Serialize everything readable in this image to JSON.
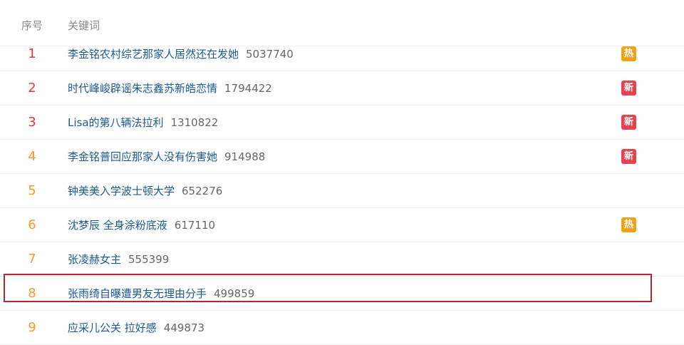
{
  "header": {
    "rank_label": "序号",
    "keyword_label": "关键词"
  },
  "colors": {
    "rank_top": "#e5393a",
    "rank_rest": "#f59b2b",
    "link": "#1a5a93",
    "tag_hot": "#f0a317",
    "tag_new": "#e8424c",
    "highlight": "#b8252c"
  },
  "rows": [
    {
      "rank": "1",
      "keyword": "李金铭农村综艺那家人居然还在发她",
      "count": "5037740",
      "tag": "热",
      "tag_type": "hot"
    },
    {
      "rank": "2",
      "keyword": "时代峰峻辟谣朱志鑫苏新皓恋情",
      "count": "1794422",
      "tag": "新",
      "tag_type": "new"
    },
    {
      "rank": "3",
      "keyword": "Lisa的第八辆法拉利",
      "count": "1310822",
      "tag": "新",
      "tag_type": "new"
    },
    {
      "rank": "4",
      "keyword": "李金铭普回应那家人没有伤害她",
      "count": "914988",
      "tag": "新",
      "tag_type": "new"
    },
    {
      "rank": "5",
      "keyword": "钟美美入学波士顿大学",
      "count": "652276",
      "tag": "",
      "tag_type": ""
    },
    {
      "rank": "6",
      "keyword": "沈梦辰 全身涂粉底液",
      "count": "617110",
      "tag": "热",
      "tag_type": "hot"
    },
    {
      "rank": "7",
      "keyword": "张凌赫女主",
      "count": "555399",
      "tag": "",
      "tag_type": ""
    },
    {
      "rank": "8",
      "keyword": "张雨绮自曝遭男友无理由分手",
      "count": "499859",
      "tag": "",
      "tag_type": "",
      "highlighted": true
    },
    {
      "rank": "9",
      "keyword": "应采儿公关 拉好感",
      "count": "449873",
      "tag": "",
      "tag_type": ""
    }
  ]
}
